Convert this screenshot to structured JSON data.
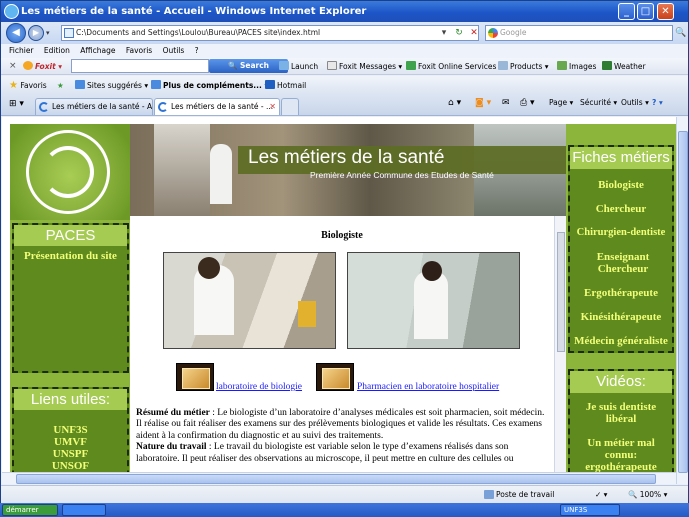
{
  "window": {
    "title": "Les métiers de la santé - Accueil - Windows Internet Explorer"
  },
  "address_bar": {
    "url": "C:\\Documents and Settings\\Loulou\\Bureau\\PACES site\\index.html"
  },
  "search_box": {
    "placeholder": "Google"
  },
  "menu": [
    "Fichier",
    "Edition",
    "Affichage",
    "Favoris",
    "Outils",
    "?"
  ],
  "foxit_toolbar": {
    "close": "×",
    "brand": "Foxit",
    "search_label": "Search",
    "items": [
      "Launch",
      "Foxit Messages",
      "Foxit Online Services",
      "Products",
      "Images",
      "Weather"
    ]
  },
  "favorites_bar": {
    "favoris": "Favoris",
    "sites_suggeres": "Sites suggérés",
    "plus_complements": "Plus de compléments...",
    "hotmail": "Hotmail"
  },
  "tabs": [
    {
      "label": "Les métiers de la santé - Acc...",
      "active": false
    },
    {
      "label": "Les métiers de la santé - ...",
      "active": true
    }
  ],
  "command_bar": {
    "page": "Page",
    "securite": "Sécurité",
    "outils": "Outils"
  },
  "page": {
    "banner_title": "Les métiers de la santé",
    "banner_subtitle": "Première Année Commune des Etudes de Santé",
    "left_boxes": {
      "paces_title": "PACES",
      "paces_link": "Présentation du site",
      "liens_title": "Liens utiles:",
      "liens": [
        "UNF3S",
        "UMVF",
        "UNSPF",
        "UNSOF"
      ]
    },
    "article": {
      "title": "Biologiste",
      "video_link_1": "laboratoire de biologie",
      "video_link_2": "Pharmacien en laboratoire hospitalier",
      "resume_label": "Résumé du métier",
      "resume_text": " : Le biologiste d’un laboratoire d’analyses médicales est soit pharmacien, soit médecin. Il réalise ou fait réaliser des examens sur des prélèvements biologiques et valide les résultats. Ces examens aident à la confirmation du diagnostic et au suivi des traitements.",
      "nature_label": "Nature du travail",
      "nature_text": " : Le travail du biologiste est variable selon le type d’examens réalisés dans son laboratoire. Il peut réaliser des observations au microscope, il peut mettre en culture des cellules ou"
    },
    "right_boxes": {
      "fiches_title": "Fiches métiers",
      "fiches": [
        "Biologiste",
        "Chercheur",
        "Chirurgien-dentiste",
        "Enseignant Chercheur",
        "Ergothérapeute",
        "Kinésithérapeute",
        "Médecin généraliste"
      ],
      "videos_title": "Vidéos:",
      "videos": [
        "Je suis dentiste libéral",
        "Un métier mal connu: ergothérapeute"
      ]
    }
  },
  "status_bar": {
    "zone": "Poste de travail",
    "zoom": "100%"
  },
  "taskbar": [
    "démarrer",
    "UNF3S"
  ]
}
